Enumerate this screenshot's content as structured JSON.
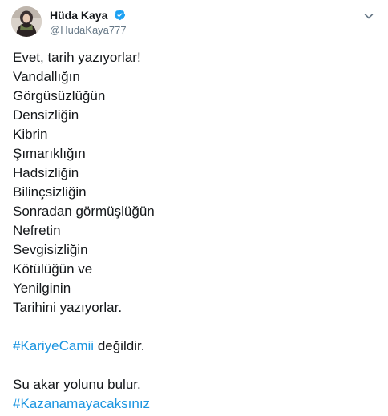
{
  "author": {
    "display_name": "Hüda Kaya",
    "handle": "@HudaKaya777",
    "verified": true
  },
  "colors": {
    "text": "#14171a",
    "secondary": "#657786",
    "link": "#1b95e0",
    "verified_badge": "#1da1f2"
  },
  "icons": {
    "verified": "verified-badge-icon",
    "menu": "chevron-down-icon"
  },
  "tweet": {
    "lines": [
      "Evet, tarih yazıyorlar!",
      "Vandallığın",
      "Görgüsüzlüğün",
      "Densizliğin",
      "Kibrin",
      "Şımarıklığın",
      "Hadsizliğin",
      "Bilinçsizliğin",
      "Sonradan görmüşlüğün",
      "Nefretin",
      "Sevgisizliğin",
      "Kötülüğün ve",
      "Yenilginin",
      "Tarihini yazıyorlar."
    ],
    "hashtag1": "#KariyeCamii",
    "hashtag1_suffix": " değildir.",
    "closing_line": "Su akar yolunu bulur.",
    "hashtag2": "#Kazanamayacaksınız"
  }
}
